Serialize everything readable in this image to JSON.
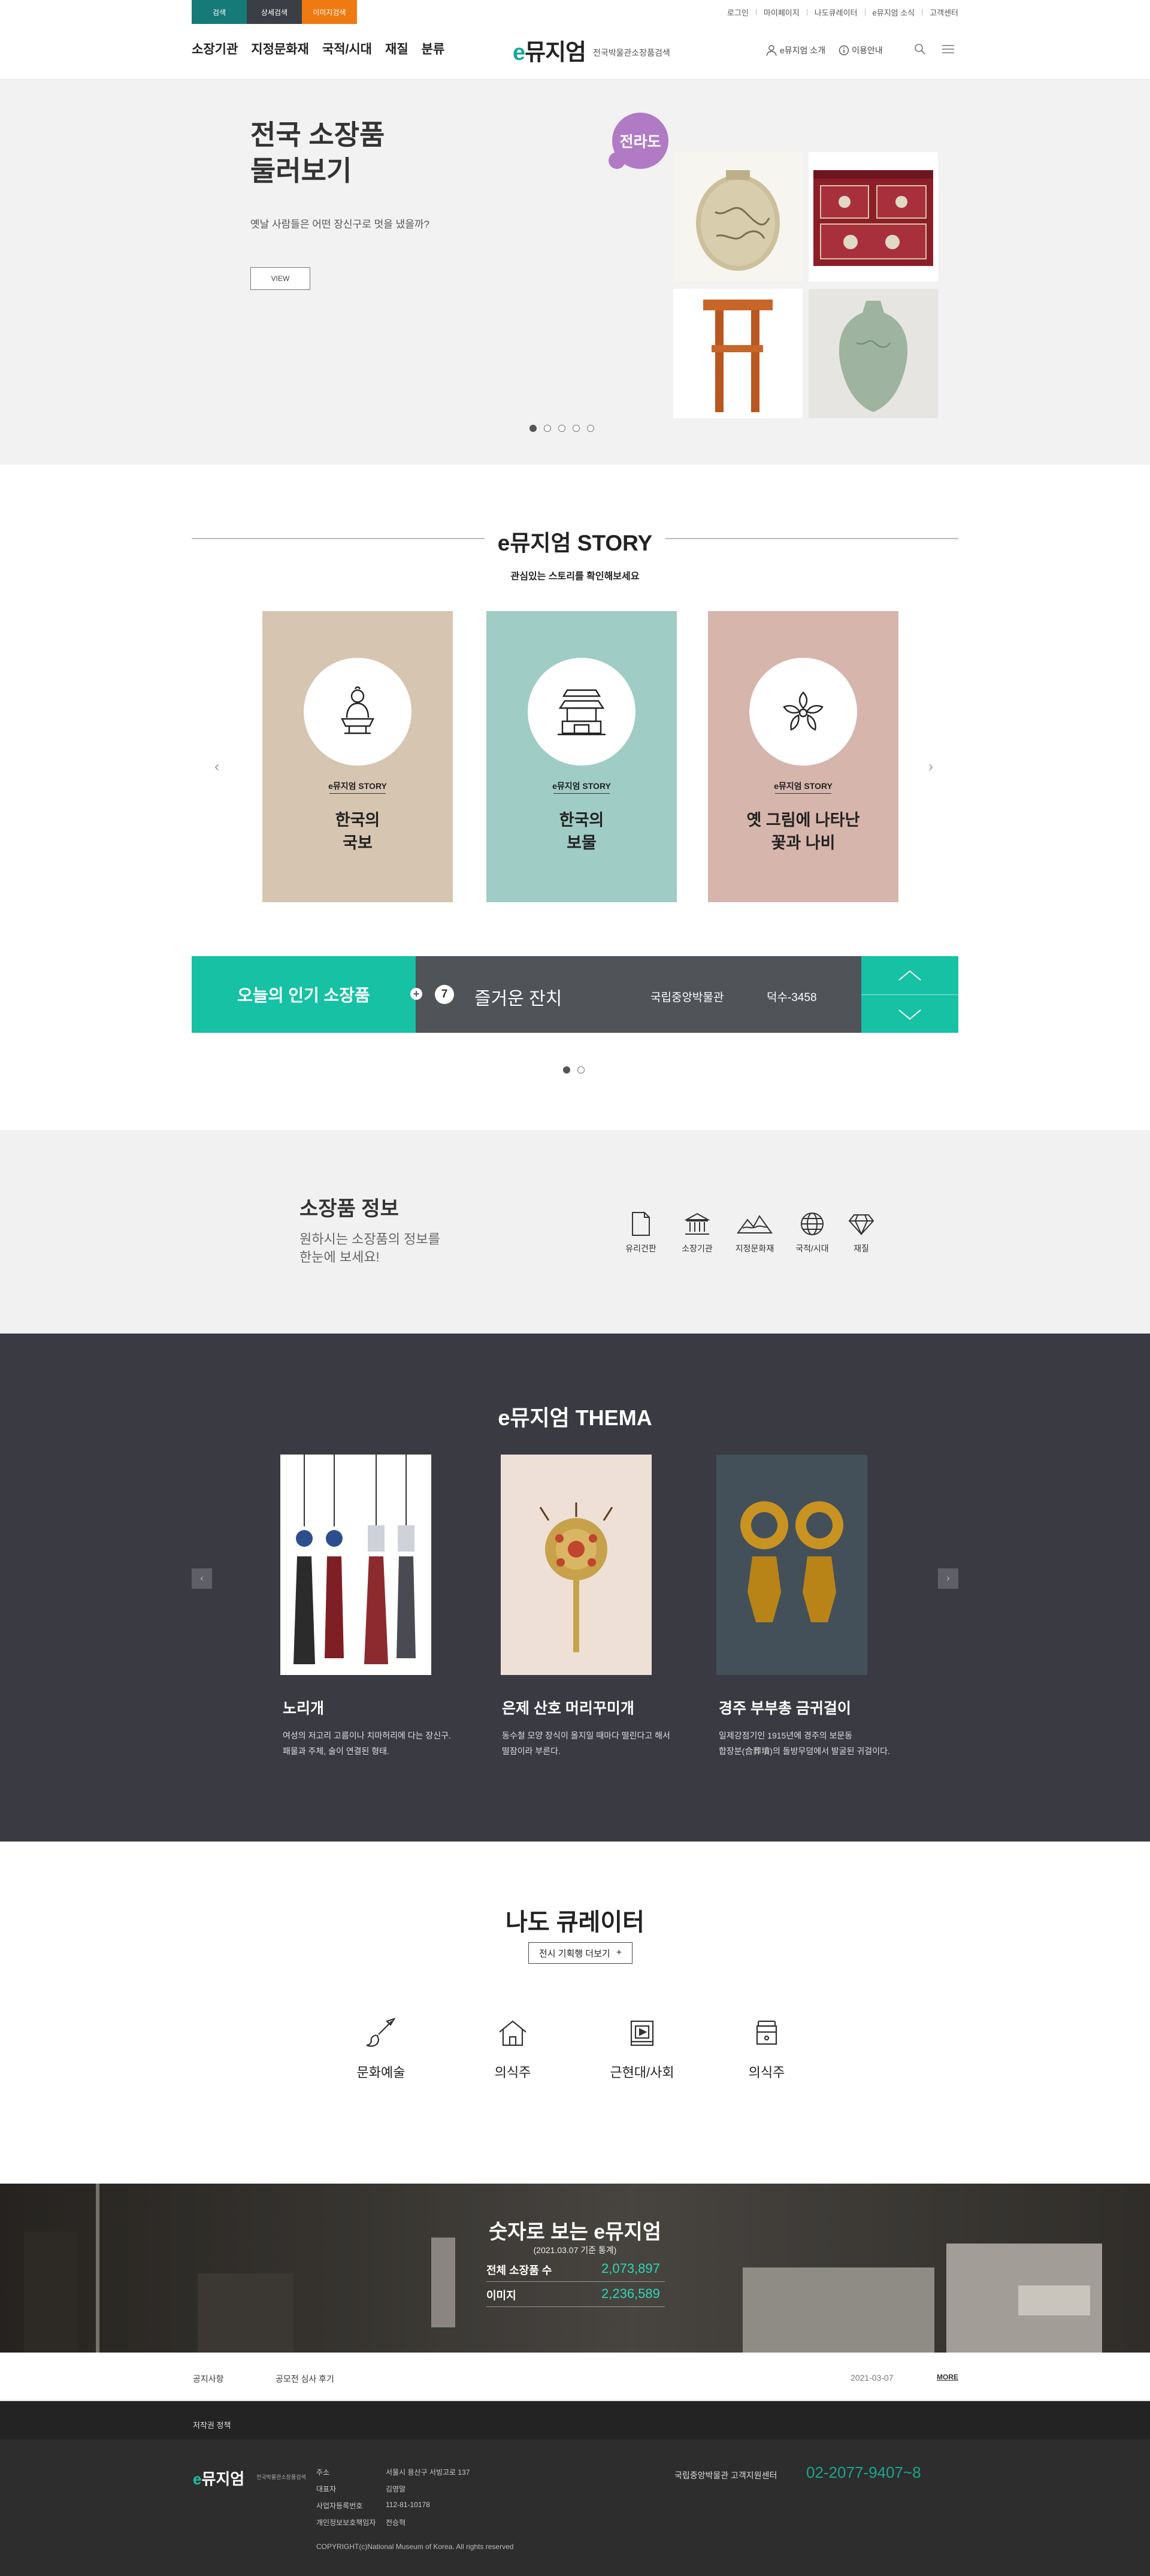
{
  "utility": {
    "tabs": [
      {
        "label": "검색",
        "color": "#157a78"
      },
      {
        "label": "상세검색",
        "color": "#3c3e45"
      },
      {
        "label": "이미지검색",
        "color": "#f07a12"
      }
    ],
    "links": [
      "로그인",
      "마이페이지",
      "나도큐레이터",
      "e뮤지엄 소식",
      "고객센터"
    ]
  },
  "gnb": [
    "소장기관",
    "지정문화재",
    "국적/시대",
    "재질",
    "분류"
  ],
  "logo": {
    "e": "e",
    "rest": "뮤지엄",
    "sub": "전국박물관소장품검색"
  },
  "header_links": [
    "e뮤지엄 소개",
    "이용안내"
  ],
  "hero": {
    "title_line1": "전국 소장품",
    "title_line2": "둘러보기",
    "desc": "옛날 사람들은 어떤 장신구로 멋을 냈을까?",
    "button": "VIEW",
    "region": "전라도",
    "slides_active": 0,
    "slides_total": 5
  },
  "story": {
    "title": "e뮤지엄 STORY",
    "sub": "관심있는 스토리를 확인해보세요",
    "cards": [
      {
        "kicker": "e뮤지엄 STORY",
        "line1": "한국의",
        "line2": "국보",
        "bg": "#d6c5b0",
        "icon": "buddha-statue-icon"
      },
      {
        "kicker": "e뮤지엄 STORY",
        "line1": "한국의",
        "line2": "보물",
        "bg": "#9fccc5",
        "icon": "palace-gate-icon"
      },
      {
        "kicker": "e뮤지엄 STORY",
        "line1": "옛 그림에 나타난",
        "line2": "꽃과 나비",
        "bg": "#d6b5ad",
        "icon": "flower-icon"
      }
    ]
  },
  "popular": {
    "label": "오늘의 인기 소장품",
    "rank": "7",
    "name": "즐거운 잔치",
    "museum": "국립중앙박물관",
    "code": "덕수-3458",
    "slides_active": 0,
    "slides_total": 2
  },
  "info": {
    "title": "소장품 정보",
    "desc_line1": "원하시는 소장품의 정보를",
    "desc_line2": "한눈에 보세요!",
    "items": [
      "유리건판",
      "소장기관",
      "지정문화재",
      "국적/시대",
      "재질"
    ]
  },
  "thema": {
    "title": "e뮤지엄 THEMA",
    "items": [
      {
        "name": "노리개",
        "desc1": "여성의 저고리 고름이나 치마허리에 다는 장신구.",
        "desc2": "패물과 주체, 술이 연결된 형태."
      },
      {
        "name": "은제 산호 머리꾸미개",
        "desc1": "동수철 모양 장식이 올지일 때마다 떨린다고 해서",
        "desc2": "떨잠이라 부른다."
      },
      {
        "name": "경주 부부총 금귀걸이",
        "desc1": "일제강점기인 1915년에 경주의 보문동",
        "desc2": "합장분(合葬墳)의 돌방무덤에서 발굴된 귀걸이다."
      }
    ]
  },
  "curator": {
    "title": "나도 큐레이터",
    "button": "전시 기획행 더보기",
    "items": [
      "문화예술",
      "의식주",
      "근현대/사회",
      "의식주"
    ]
  },
  "numbers": {
    "title": "숫자로 보는 e뮤지엄",
    "sub": "(2021.03.07 기준 통계)",
    "rows": [
      {
        "label": "전체 소장품 수",
        "value": "2,073,897"
      },
      {
        "label": "이미지",
        "value": "2,236,589"
      }
    ]
  },
  "notice": {
    "category": "공지사항",
    "title": "공모전 심사 후기",
    "date": "2021-03-07",
    "more": "MORE"
  },
  "footer": {
    "top_link": "저작권 정책",
    "logo_e": "e",
    "logo_rest": "뮤지엄",
    "logo_sub": "전국박물관소장품검색",
    "rows": [
      {
        "label": "주소",
        "value": "서울시 용산구 서빙고로 137"
      },
      {
        "label": "대표자",
        "value": "김영말"
      },
      {
        "label": "사업자등록번호",
        "value": "112-81-10178"
      },
      {
        "label": "개인정보보호책임자",
        "value": "전승혁"
      }
    ],
    "copyright": "COPYRIGHT(c)National Museum of Korea. All rights reserved",
    "cs_label": "국립중앙박물관 고객지원센터",
    "phone": "02-2077-9407~8"
  }
}
